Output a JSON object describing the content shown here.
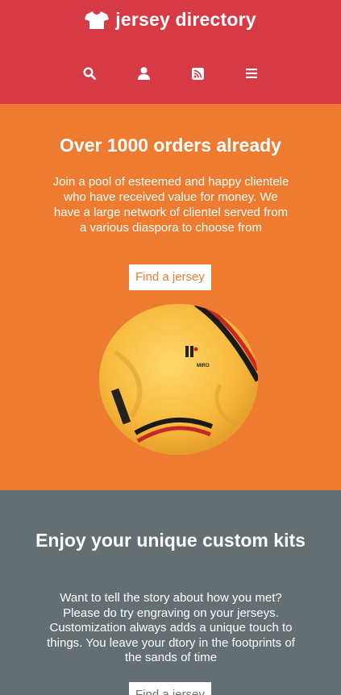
{
  "header": {
    "brand_icon": "tshirt-icon",
    "brand_title": "jersey directory",
    "nav": [
      {
        "icon": "search-icon"
      },
      {
        "icon": "user-icon"
      },
      {
        "icon": "rss-icon"
      },
      {
        "icon": "menu-icon"
      }
    ]
  },
  "hero": {
    "title": "Over 1000 orders already",
    "text": "Join a pool of esteemed and happy clientele who have received value for money. We have a large network of clientel served from a various diaspora to choose from",
    "button_label": "Find a jersey"
  },
  "custom": {
    "title": "Enjoy your unique custom kits",
    "text": "Want to tell the story about how you met? Please do try engraving on your jerseys. Customization always adds a unique touch to things. You leave your dtory in the footprints of the sands of time",
    "button_label": "Find a jersey"
  },
  "colors": {
    "header_bg": "#d63a45",
    "hero_bg": "#ef7b30",
    "custom_bg": "#646f73"
  }
}
